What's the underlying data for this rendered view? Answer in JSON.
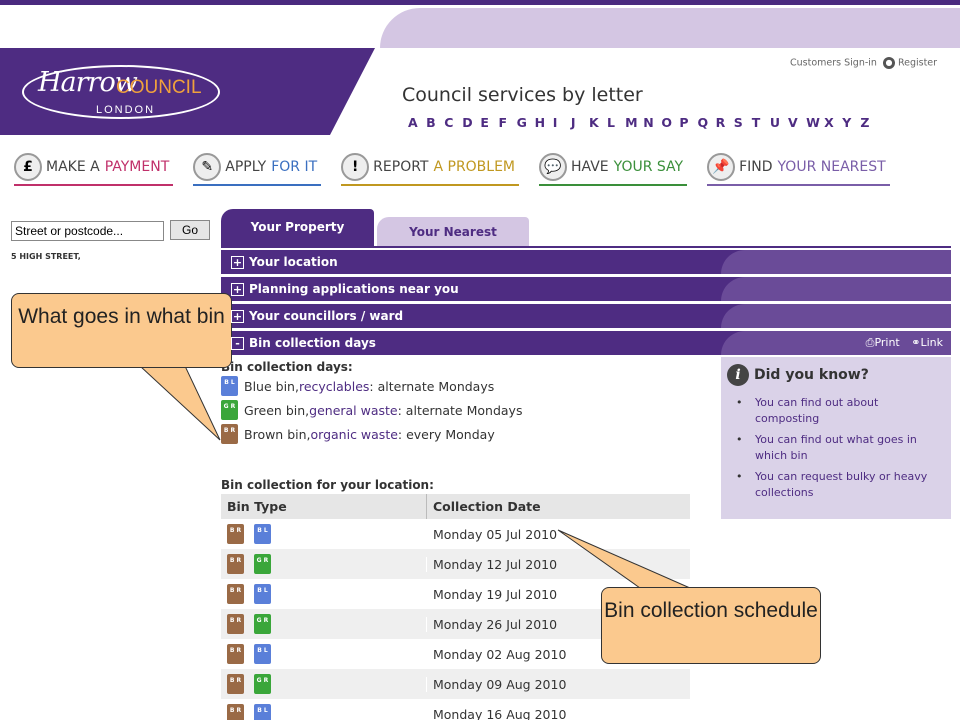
{
  "header": {
    "logo_harrow": "Harrow",
    "logo_council": "COUNCIL",
    "logo_london": "LONDON",
    "signin": "Customers Sign-in",
    "register": "Register",
    "services_title": "Council services by letter",
    "alphabet": [
      "A",
      "B",
      "C",
      "D",
      "E",
      "F",
      "G",
      "H",
      "I",
      "J",
      "K",
      "L",
      "M",
      "N",
      "O",
      "P",
      "Q",
      "R",
      "S",
      "T",
      "U",
      "V",
      "W",
      "X",
      "Y",
      "Z"
    ]
  },
  "nav": [
    {
      "w1": "MAKE A",
      "w2": "PAYMENT",
      "color": "#c0306a",
      "icon": "pound-icon",
      "glyph": "£"
    },
    {
      "w1": "APPLY",
      "w2": "FOR IT",
      "color": "#3a6fc0",
      "icon": "pencil-icon",
      "glyph": "✎"
    },
    {
      "w1": "REPORT",
      "w2": "A PROBLEM",
      "color": "#c09820",
      "icon": "exclamation-icon",
      "glyph": "!"
    },
    {
      "w1": "HAVE",
      "w2": "YOUR SAY",
      "color": "#3a8f3a",
      "icon": "speech-bubble-icon",
      "glyph": "💬"
    },
    {
      "w1": "FIND",
      "w2": "YOUR NEAREST",
      "color": "#7a5ea8",
      "icon": "pin-icon",
      "glyph": "📌"
    }
  ],
  "search": {
    "value": "Street or postcode...",
    "go_label": "Go",
    "address": "5 HIGH STREET,"
  },
  "tabs": {
    "property": "Your Property",
    "nearest": "Your Nearest"
  },
  "accordion": {
    "location": "Your location",
    "planning": "Planning applications near you",
    "councillors": "Your councillors / ward",
    "bins": "Bin collection days",
    "plus": "+",
    "minus": "-",
    "print": "Print",
    "link": "Link"
  },
  "bins": {
    "heading": "Bin collection days:",
    "blue_pre": "Blue bin, ",
    "blue_link": "recyclables",
    "blue_post": ": alternate Mondays",
    "green_pre": "Green bin, ",
    "green_link": "general waste",
    "green_post": ": alternate Mondays",
    "brown_pre": "Brown bin, ",
    "brown_link": "organic waste",
    "brown_post": ": every Monday",
    "icon_labels": {
      "blue": "B L",
      "green": "G R",
      "brown": "B R"
    }
  },
  "schedule": {
    "heading": "Bin collection for your location:",
    "col_type": "Bin Type",
    "col_date": "Collection Date",
    "rows": [
      {
        "bins": [
          "brown",
          "blue"
        ],
        "date": "Monday 05 Jul 2010"
      },
      {
        "bins": [
          "brown",
          "green"
        ],
        "date": "Monday 12 Jul 2010"
      },
      {
        "bins": [
          "brown",
          "blue"
        ],
        "date": "Monday 19 Jul 2010"
      },
      {
        "bins": [
          "brown",
          "green"
        ],
        "date": "Monday 26 Jul 2010"
      },
      {
        "bins": [
          "brown",
          "blue"
        ],
        "date": "Monday 02 Aug 2010"
      },
      {
        "bins": [
          "brown",
          "green"
        ],
        "date": "Monday 09 Aug 2010"
      },
      {
        "bins": [
          "brown",
          "blue"
        ],
        "date": "Monday 16 Aug 2010"
      }
    ]
  },
  "did_you_know": {
    "title": "Did you know?",
    "items": [
      "You can find out about composting",
      "You can find out what goes in which bin",
      "You can request bulky or heavy collections"
    ]
  },
  "callouts": {
    "what_bin": "What goes in what bin",
    "schedule": "Bin collection schedule"
  },
  "colors": {
    "brand_purple": "#4e2c82",
    "light_purple": "#d4c6e3",
    "callout": "#fbc98e",
    "accent_orange": "#f0a13c"
  }
}
